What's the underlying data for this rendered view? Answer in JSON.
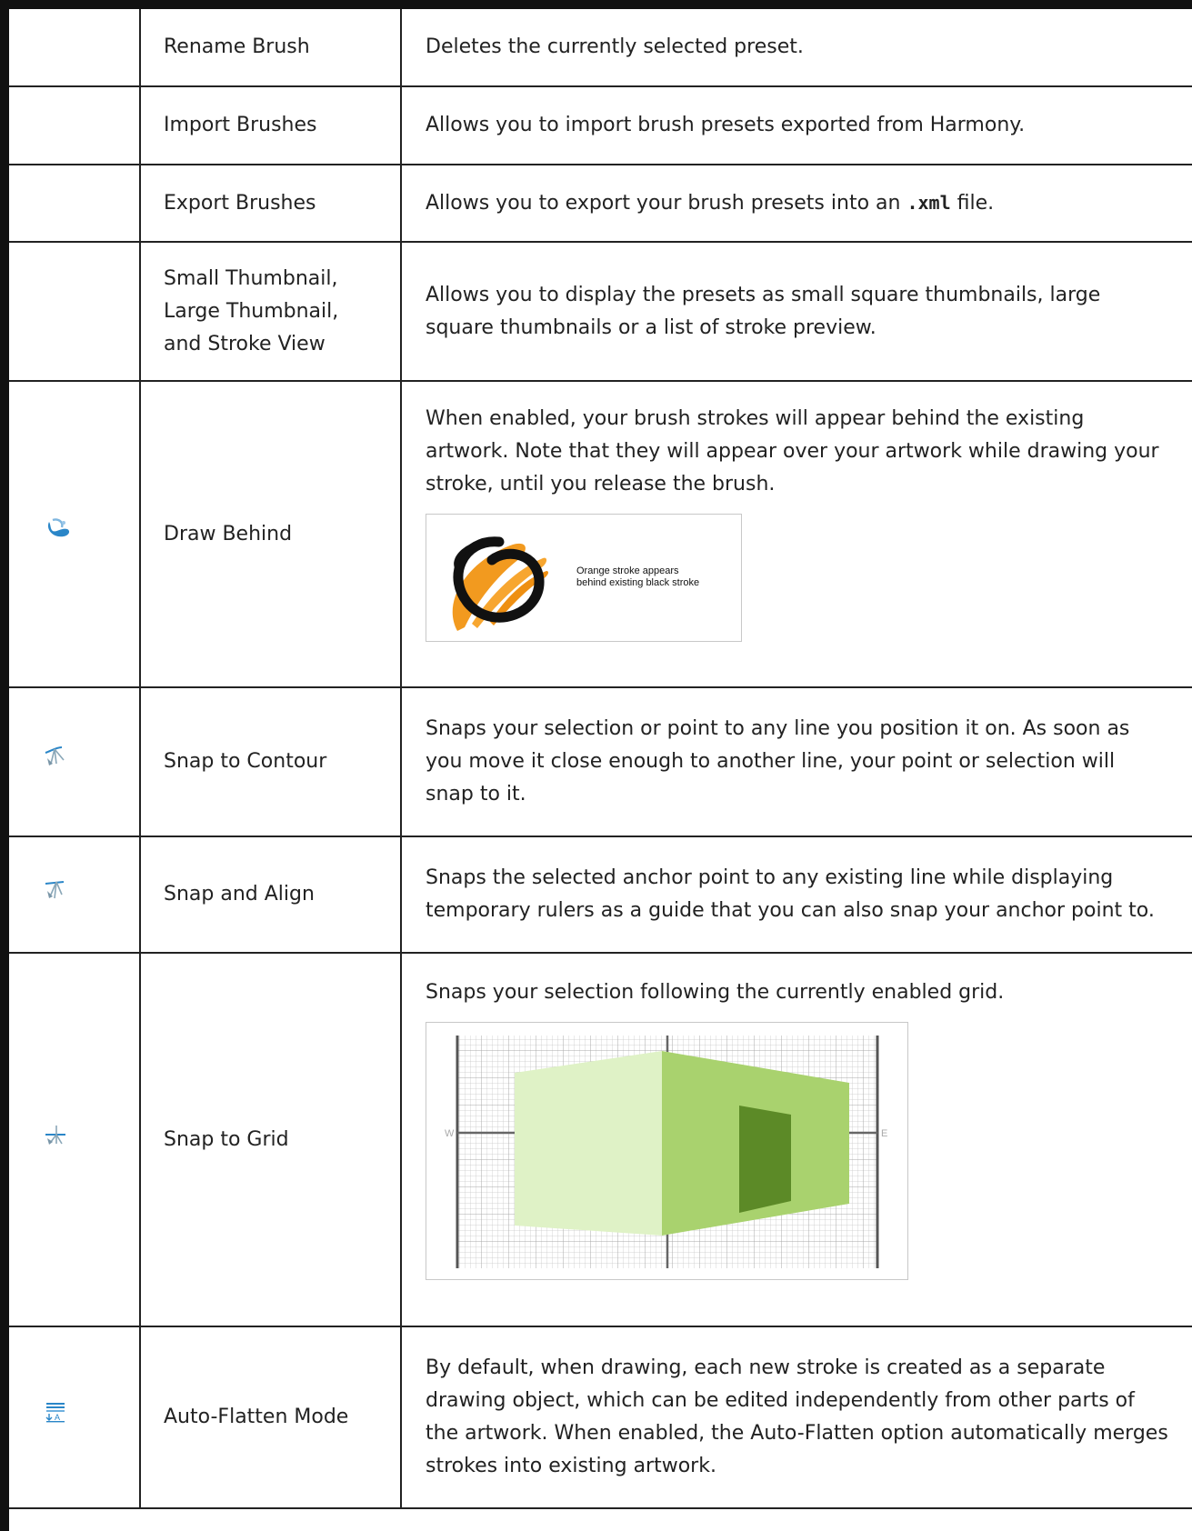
{
  "rows": [
    {
      "icon": "",
      "name": "Rename Brush",
      "desc": "Deletes the currently selected preset."
    },
    {
      "icon": "",
      "name": "Import Brushes",
      "desc": "Allows you to import brush presets exported from Harmony."
    },
    {
      "icon": "",
      "name": "Export Brushes",
      "desc_pre": "Allows you to export your brush presets into an ",
      "desc_code": ".xml",
      "desc_post": " file."
    },
    {
      "icon": "",
      "name": "Small Thumbnail, Large Thumbnail, and Stroke View",
      "desc": "Allows you to display the presets as small square thumbnails, large square thumbnails or a list of stroke preview."
    },
    {
      "icon": "draw-behind-icon",
      "name": "Draw Behind",
      "desc": "When enabled, your brush strokes will appear behind the existing artwork. Note that they will appear over your artwork while drawing your stroke, until you release the brush.",
      "figure_caption_1": "Orange stroke appears",
      "figure_caption_2": "behind existing black stroke"
    },
    {
      "icon": "snap-to-contour-icon",
      "name": "Snap to Contour",
      "desc": "Snaps your selection or point to any line you position it on. As soon as you move it close enough to another line, your point or selection will snap to it."
    },
    {
      "icon": "snap-and-align-icon",
      "name": "Snap and Align",
      "desc": "Snaps the selected anchor point to any existing line while displaying temporary rulers as a guide that you can also snap your anchor point to."
    },
    {
      "icon": "snap-to-grid-icon",
      "name": "Snap to Grid",
      "desc": "Snaps your selection following the currently enabled grid.",
      "grid_label_left": "W",
      "grid_label_right": "E"
    },
    {
      "icon": "auto-flatten-icon",
      "name": "Auto-Flatten Mode",
      "desc": "By default, when drawing, each new stroke is created as a separate drawing object, which can be edited independently from other parts of the artwork. When enabled, the Auto-Flatten option automatically merges strokes into existing artwork."
    }
  ],
  "colors": {
    "orange": "#f29a1f",
    "icon_blue": "#2a86c8",
    "light_green": "#dff2c6",
    "mid_green": "#a9d26e",
    "dark_green": "#5c8a27"
  }
}
